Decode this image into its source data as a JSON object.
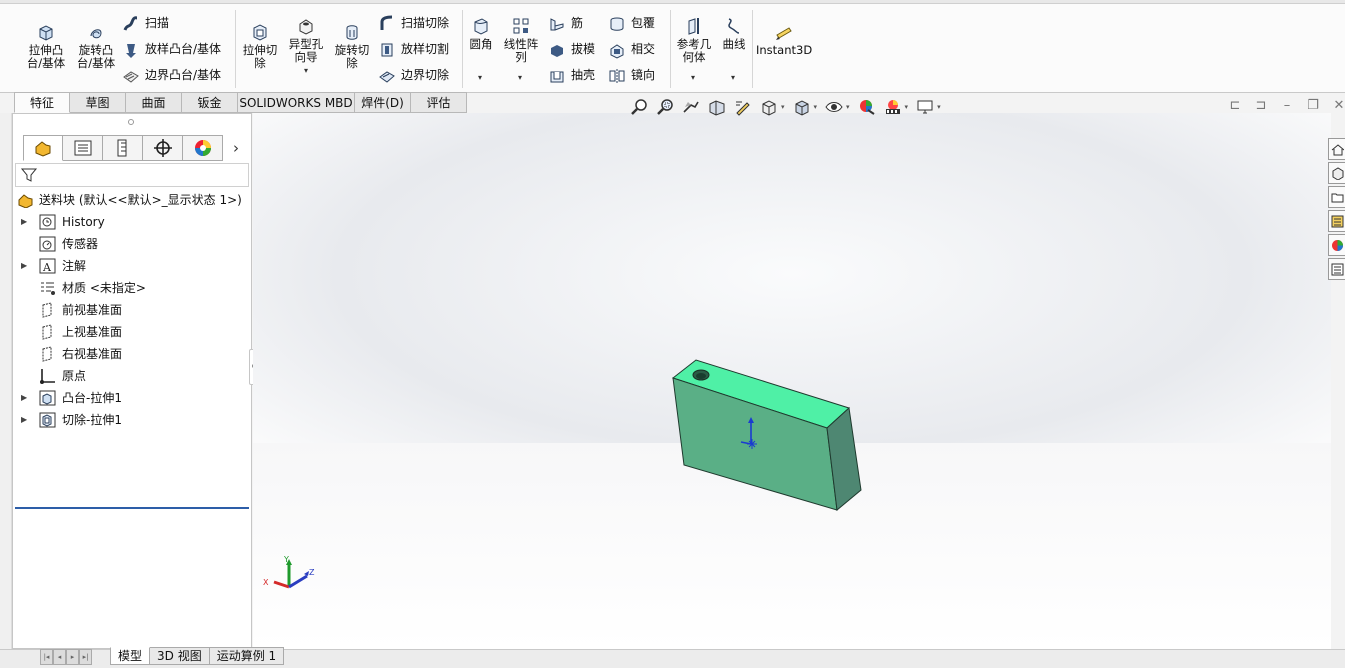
{
  "ribbon": {
    "extrude_boss": "拉伸凸\n台/基体",
    "revolve_boss": "旋转凸\n台/基体",
    "sweep": "扫描",
    "loft_boss": "放样凸台/基体",
    "boundary_boss": "边界凸台/基体",
    "extrude_cut": "拉伸切\n除",
    "hole_wizard": "异型孔\n向导",
    "revolve_cut": "旋转切\n除",
    "swept_cut": "扫描切除",
    "lofted_cut": "放样切割",
    "boundary_cut": "边界切除",
    "fillet": "圆角",
    "linear_pattern": "线性阵\n列",
    "rib": "筋",
    "draft": "拔模",
    "shell": "抽壳",
    "wrap": "包覆",
    "intersect": "相交",
    "mirror": "镜向",
    "ref_geometry": "参考几\n何体",
    "curves": "曲线",
    "instant3d": "Instant3D"
  },
  "command_tabs": [
    "特征",
    "草图",
    "曲面",
    "钣金",
    "SOLIDWORKS MBD",
    "焊件(D)",
    "评估"
  ],
  "tree": {
    "root": "送料块  (默认<<默认>_显示状态 1>)",
    "items": [
      {
        "label": "History",
        "icon": "history-icon",
        "expandable": true
      },
      {
        "label": "传感器",
        "icon": "sensor-icon",
        "expandable": false
      },
      {
        "label": "注解",
        "icon": "annotation-icon",
        "expandable": true
      },
      {
        "label": "材质 <未指定>",
        "icon": "material-icon",
        "expandable": false
      },
      {
        "label": "前视基准面",
        "icon": "plane-icon",
        "expandable": false
      },
      {
        "label": "上视基准面",
        "icon": "plane-icon",
        "expandable": false
      },
      {
        "label": "右视基准面",
        "icon": "plane-icon",
        "expandable": false
      },
      {
        "label": "原点",
        "icon": "origin-icon",
        "expandable": false
      },
      {
        "label": "凸台-拉伸1",
        "icon": "boss-extrude-icon",
        "expandable": true
      },
      {
        "label": "切除-拉伸1",
        "icon": "cut-extrude-icon",
        "expandable": true
      }
    ]
  },
  "bottom_tabs": [
    "模型",
    "3D 视图",
    "运动算例 1"
  ],
  "triad": {
    "x": "X",
    "y": "Y",
    "z": "Z"
  },
  "colors": {
    "part_top": "#4ff0a6",
    "part_front": "#5aaf86",
    "part_side": "#4e8772",
    "accent": "#2d5ea8"
  }
}
